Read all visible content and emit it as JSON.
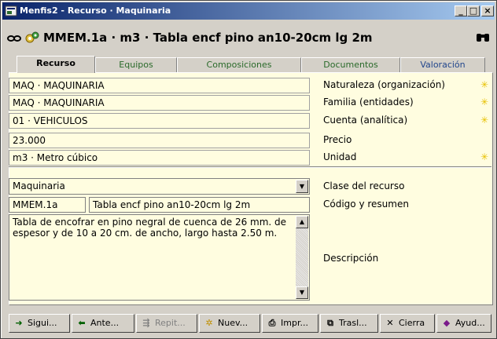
{
  "window": {
    "title": "Menfis2 - Recurso · Maquinaria"
  },
  "header": {
    "title": "MMEM.1a · m3 · Tabla encf  pino an10-20cm lg 2m"
  },
  "tabs": [
    {
      "label": "Recurso"
    },
    {
      "label": "Equipos"
    },
    {
      "label": "Composiciones"
    },
    {
      "label": "Documentos"
    },
    {
      "label": "Valoración"
    }
  ],
  "fields": {
    "naturaleza": {
      "value": "MAQ · MAQUINARIA",
      "label": "Naturaleza (organización)"
    },
    "familia": {
      "value": "MAQ · MAQUINARIA",
      "label": "Familia (entidades)"
    },
    "cuenta": {
      "value": "01 · VEHICULOS",
      "label": "Cuenta (analítica)"
    },
    "precio": {
      "value": "23.000",
      "label": "Precio"
    },
    "unidad": {
      "value": "m3 · Metro cúbico",
      "label": "Unidad"
    },
    "clase": {
      "value": "Maquinaria",
      "label": "Clase del recurso"
    },
    "codigo": {
      "code": "MMEM.1a",
      "summary": "Tabla encf  pino an10-20cm lg 2m",
      "label": "Código y resumen"
    },
    "descripcion": {
      "value": "Tabla de encofrar en pino negral de cuenca de 26 mm. de espesor y de 10 a 20 cm. de ancho, largo hasta 2.50 m.",
      "label": "Descripción"
    }
  },
  "toolbar": [
    {
      "label": "Sigui...",
      "icon": "arrow-right-icon",
      "enabled": true
    },
    {
      "label": "Ante...",
      "icon": "arrow-left-icon",
      "enabled": true
    },
    {
      "label": "Repit...",
      "icon": "repeat-icon",
      "enabled": false
    },
    {
      "label": "Nuev...",
      "icon": "new-icon",
      "enabled": true
    },
    {
      "label": "Impr...",
      "icon": "printer-icon",
      "enabled": true
    },
    {
      "label": "Trasl...",
      "icon": "transfer-icon",
      "enabled": true
    },
    {
      "label": "Cierra",
      "icon": "close-icon",
      "enabled": true
    },
    {
      "label": "Ayud...",
      "icon": "help-book-icon",
      "enabled": true
    }
  ],
  "colors": {
    "titlebar": "#0a246a",
    "field_bg": "#fffde0",
    "star": "#e7c000"
  }
}
